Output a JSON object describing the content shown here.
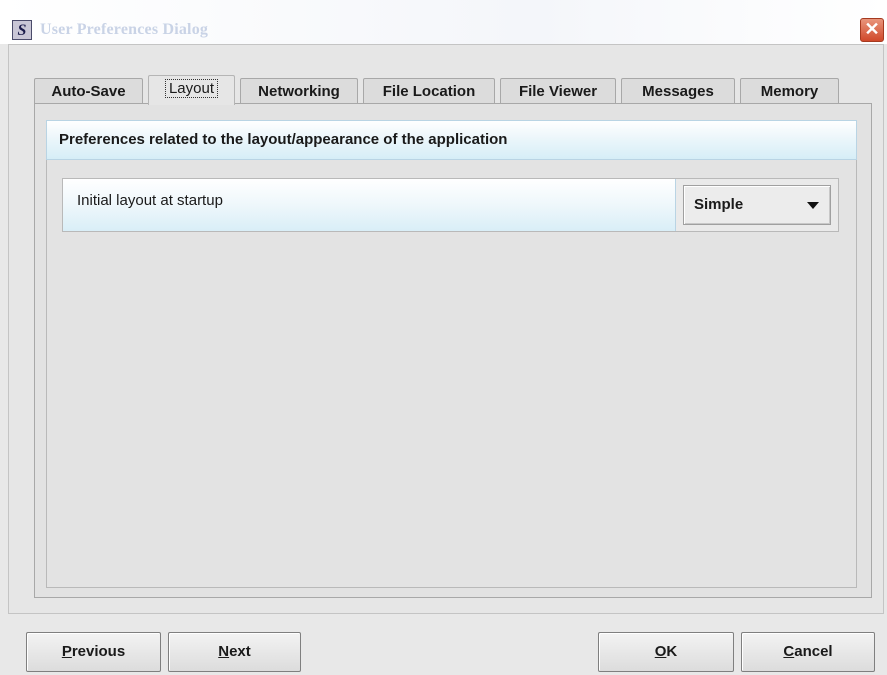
{
  "window": {
    "title": "User Preferences Dialog",
    "icon_letter": "S",
    "close_glyph": "✕"
  },
  "tabs": [
    {
      "label": "Auto-Save",
      "active": false
    },
    {
      "label": "Layout",
      "active": true
    },
    {
      "label": "Networking",
      "active": false
    },
    {
      "label": "File Location",
      "active": false
    },
    {
      "label": "File Viewer",
      "active": false
    },
    {
      "label": "Messages",
      "active": false
    },
    {
      "label": "Memory",
      "active": false
    }
  ],
  "panel": {
    "header": "Preferences related to the layout/appearance of the application",
    "rows": [
      {
        "label": "Initial layout at startup",
        "value": "Simple",
        "icon": "chevron-down-icon"
      }
    ]
  },
  "buttons": {
    "previous": {
      "mnemonic": "P",
      "rest": "revious"
    },
    "next": {
      "mnemonic": "N",
      "rest": "ext"
    },
    "ok": {
      "mnemonic": "O",
      "rest": "K"
    },
    "cancel": {
      "mnemonic": "C",
      "rest": "ancel"
    }
  },
  "colors": {
    "header_gradient_end": "#d6eef7",
    "close_button": "#d0482a"
  }
}
